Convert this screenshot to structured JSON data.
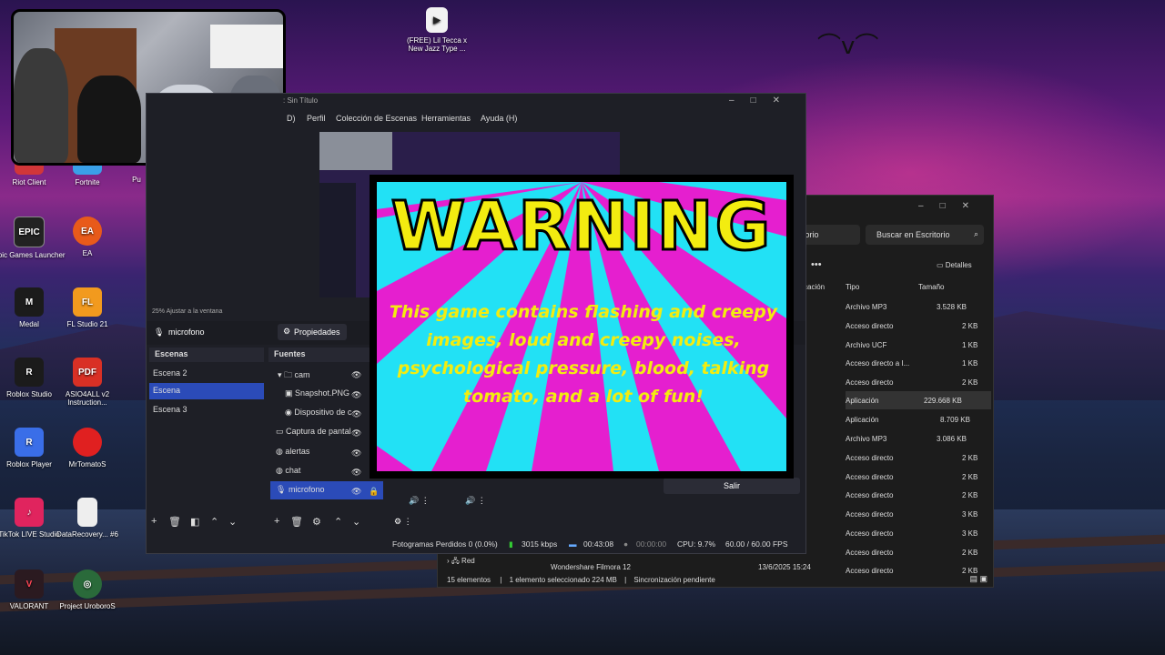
{
  "desktop": {
    "top_file_label": "(FREE) Lil Tecca x New Jazz Type ...",
    "icons_col1": [
      {
        "label": "Riot Client",
        "glyph": "riot",
        "color": "#d13639"
      },
      {
        "label": "Epic Games Launcher",
        "glyph": "EPIC",
        "color": "#222222"
      },
      {
        "label": "Medal",
        "glyph": "M",
        "color": "#1b1b1b"
      },
      {
        "label": "Roblox Studio",
        "glyph": "R",
        "color": "#1b1b1b"
      },
      {
        "label": "Roblox Player",
        "glyph": "R",
        "color": "#3a6ee8"
      },
      {
        "label": "TikTok LIVE Studio",
        "glyph": "♪",
        "color": "#e0245e"
      },
      {
        "label": "VALORANT",
        "glyph": "V",
        "color": "#2b1a20"
      }
    ],
    "icons_col2": [
      {
        "label": "Fortnite",
        "glyph": "F",
        "color": "#3aa0e8"
      },
      {
        "label": "EA",
        "glyph": "EA",
        "color": "#e85a1a"
      },
      {
        "label": "FL Studio 21",
        "glyph": "FL",
        "color": "#f29a1e"
      },
      {
        "label": "ASIO4ALL v2 Instruction...",
        "glyph": "PDF",
        "color": "#d93025"
      },
      {
        "label": "MrTomatoS",
        "glyph": "●",
        "color": "#e02020"
      },
      {
        "label": "DataRecovery... #6",
        "glyph": "",
        "color": "#eeeeee"
      },
      {
        "label": "Project UroboroS",
        "glyph": "◎",
        "color": "#2a6a3a"
      }
    ],
    "partial_icon_label": "Pu"
  },
  "obs": {
    "title": ": Sin Título",
    "menu": [
      "D)",
      "Perfil",
      "Colección de Escenas",
      "Herramientas",
      "Ayuda (H)"
    ],
    "zoom_text": "25%   Ajustar a la ventana",
    "source_name": "microfono",
    "properties_label": "Propiedades",
    "scenes_header": "Escenas",
    "scenes": [
      "Escena 2",
      "Escena",
      "Escena 3"
    ],
    "sources_header": "Fuentes",
    "sources": [
      "cam",
      "Snapshot.PNG",
      "Dispositivo de c",
      "Captura de pantal",
      "alertas",
      "chat",
      "microfono"
    ],
    "exit_label": "Salir",
    "status": {
      "dropped": "Fotogramas Perdidos 0 (0.0%)",
      "kbps": "3015 kbps",
      "time1": "00:43:08",
      "time2": "00:00:00",
      "cpu": "CPU: 9.7%",
      "fps": "60.00 / 60.00 FPS"
    }
  },
  "explorer": {
    "address": "ritorio",
    "search_placeholder": "Buscar en Escritorio",
    "details_label": "Detalles",
    "col_mod": "ficación",
    "col_type": "Tipo",
    "col_size": "Tamaño",
    "rows": [
      {
        "type": "Archivo MP3",
        "size": "3.528 KB"
      },
      {
        "type": "Acceso directo",
        "size": "2 KB"
      },
      {
        "type": "Archivo UCF",
        "size": "1 KB"
      },
      {
        "type": "Acceso directo a I...",
        "size": "1 KB"
      },
      {
        "type": "Acceso directo",
        "size": "2 KB"
      },
      {
        "type": "Aplicación",
        "size": "229.668 KB"
      },
      {
        "type": "Aplicación",
        "size": "8.709 KB"
      },
      {
        "type": "Archivo MP3",
        "size": "3.086 KB"
      },
      {
        "type": "Acceso directo",
        "size": "2 KB"
      },
      {
        "type": "Acceso directo",
        "size": "2 KB"
      },
      {
        "type": "Acceso directo",
        "size": "2 KB"
      },
      {
        "type": "Acceso directo",
        "size": "3 KB"
      },
      {
        "type": "Acceso directo",
        "size": "3 KB"
      },
      {
        "type": "Acceso directo",
        "size": "2 KB"
      },
      {
        "type": "Acceso directo",
        "size": "2 KB"
      }
    ],
    "filmora_label": "Wondershare Filmora 12",
    "filmora_date": "13/6/2025 15:24",
    "red_label": "Red",
    "status_count": "15 elementos",
    "status_selected": "1 elemento seleccionado  224 MB",
    "status_sync": "Sincronización pendiente"
  },
  "warning": {
    "title": "WARNING",
    "message": "This game contains flashing and creepy images, loud and creepy noises, psychological pressure, blood, talking tomato, and a lot of fun!"
  }
}
